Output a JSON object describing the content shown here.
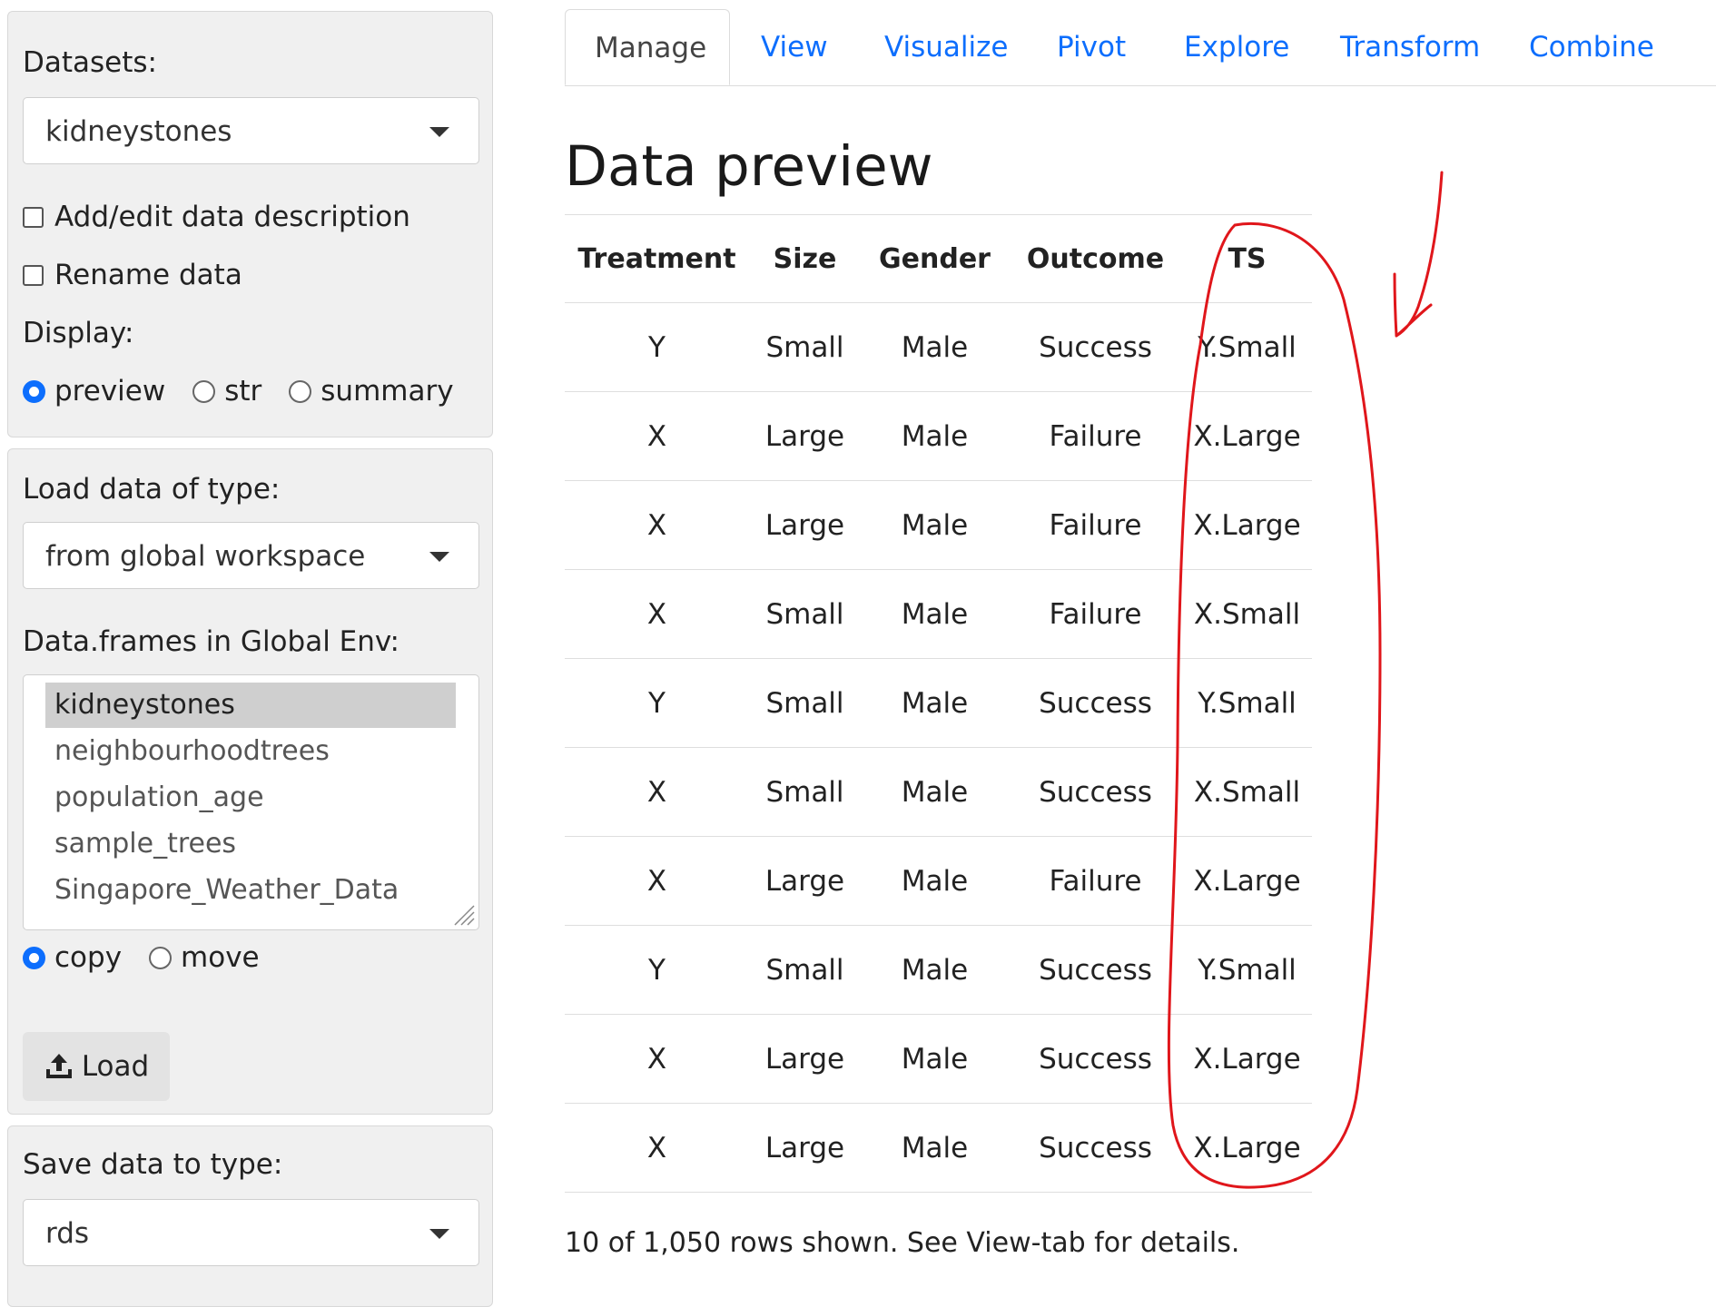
{
  "sidebar": {
    "datasets_label": "Datasets:",
    "datasets_selected": "kidneystones",
    "add_edit_description": "Add/edit data description",
    "rename_data": "Rename data",
    "display_label": "Display:",
    "display_options": [
      "preview",
      "str",
      "summary"
    ],
    "display_selected": "preview",
    "load_type_label": "Load data of type:",
    "load_type_selected": "from global workspace",
    "dataframes_label": "Data.frames in Global Env:",
    "dataframes": [
      "kidneystones",
      "neighbourhoodtrees",
      "population_age",
      "sample_trees",
      "Singapore_Weather_Data"
    ],
    "dataframes_selected": "kidneystones",
    "copy_move_options": [
      "copy",
      "move"
    ],
    "copy_move_selected": "copy",
    "load_button": "Load",
    "save_type_label": "Save data to type:",
    "save_type_selected": "rds"
  },
  "tabs": [
    "Manage",
    "View",
    "Visualize",
    "Pivot",
    "Explore",
    "Transform",
    "Combine"
  ],
  "active_tab": "Manage",
  "main": {
    "title": "Data preview",
    "table": {
      "headers": [
        "Treatment",
        "Size",
        "Gender",
        "Outcome",
        "TS"
      ],
      "rows": [
        [
          "Y",
          "Small",
          "Male",
          "Success",
          "Y.Small"
        ],
        [
          "X",
          "Large",
          "Male",
          "Failure",
          "X.Large"
        ],
        [
          "X",
          "Large",
          "Male",
          "Failure",
          "X.Large"
        ],
        [
          "X",
          "Small",
          "Male",
          "Failure",
          "X.Small"
        ],
        [
          "Y",
          "Small",
          "Male",
          "Success",
          "Y.Small"
        ],
        [
          "X",
          "Small",
          "Male",
          "Success",
          "X.Small"
        ],
        [
          "X",
          "Large",
          "Male",
          "Failure",
          "X.Large"
        ],
        [
          "Y",
          "Small",
          "Male",
          "Success",
          "Y.Small"
        ],
        [
          "X",
          "Large",
          "Male",
          "Success",
          "X.Large"
        ],
        [
          "X",
          "Large",
          "Male",
          "Success",
          "X.Large"
        ]
      ]
    },
    "footnote": "10 of 1,050 rows shown. See View-tab for details."
  },
  "annotation": {
    "color": "#e0161b"
  },
  "colors": {
    "accent": "#0d6efd",
    "panel_bg": "#f0f0f0"
  }
}
